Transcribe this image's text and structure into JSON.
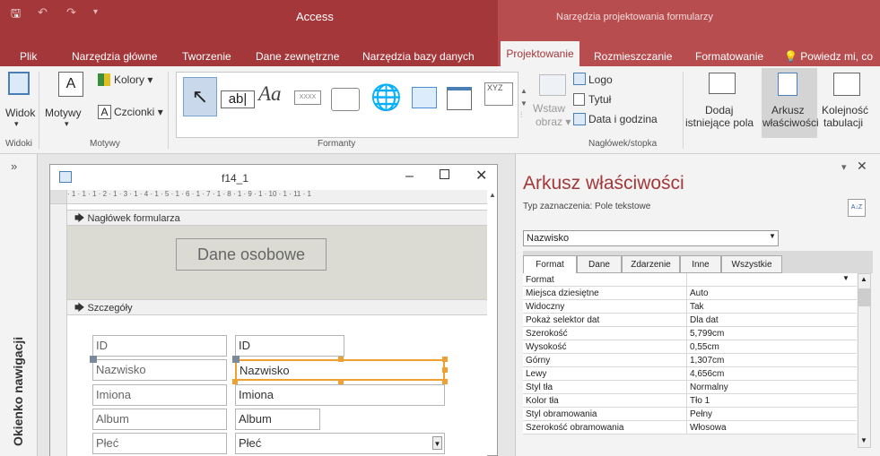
{
  "app": {
    "title": "Access",
    "context_title": "Narzędzia projektowania formularzy"
  },
  "tabs": [
    {
      "label": "Plik"
    },
    {
      "label": "Narzędzia główne"
    },
    {
      "label": "Tworzenie"
    },
    {
      "label": "Dane zewnętrzne"
    },
    {
      "label": "Narzędzia bazy danych"
    },
    {
      "label": "Projektowanie"
    },
    {
      "label": "Rozmieszczanie"
    },
    {
      "label": "Formatowanie"
    },
    {
      "label": "Powiedz mi, co"
    }
  ],
  "ribbon": {
    "widok": "Widok",
    "motywy": "Motywy",
    "kolory": "Kolory",
    "czcionki": "Czcionki",
    "wstaw_obraz_1": "Wstaw",
    "wstaw_obraz_2": "obraz",
    "logo": "Logo",
    "tytul": "Tytuł",
    "data_godzina": "Data i godzina",
    "dodaj_1": "Dodaj",
    "dodaj_2": "istniejące pola",
    "arkusz_1": "Arkusz",
    "arkusz_2": "właściwości",
    "kolejnosc_1": "Kolejność",
    "kolejnosc_2": "tabulacji",
    "gallery": {
      "abl": "ab|",
      "aa": "Aa",
      "xxxx": "XXXX",
      "xyz": "XYZ"
    },
    "groups": {
      "widoki": "Widoki",
      "motywy": "Motywy",
      "formanty": "Formanty",
      "naglowek": "Nagłówek/stopka"
    }
  },
  "nav": {
    "collapse": "»",
    "label": "Okienko nawigacji"
  },
  "form": {
    "title": "f14_1",
    "ruler": "· 1 · 1 · 1 · 2 · 1 · 3 · 1 · 4 · 1 · 5 · 1 · 6 · 1 · 7 · 1 · 8 · 1 · 9 · 1 · 10 · 1 · 11 · 1",
    "header_section": "Nagłówek formularza",
    "header_label": "Dane osobowe",
    "detail_section": "Szczegóły",
    "controls": [
      {
        "label": "ID",
        "field": "ID"
      },
      {
        "label": "Nazwisko",
        "field": "Nazwisko"
      },
      {
        "label": "Imiona",
        "field": "Imiona"
      },
      {
        "label": "Album",
        "field": "Album"
      },
      {
        "label": "Płeć",
        "field": "Płeć"
      }
    ]
  },
  "propsheet": {
    "title": "Arkusz właściwości",
    "selection_type": "Typ zaznaczenia: Pole tekstowe",
    "selected_object": "Nazwisko",
    "sort_icon": "A↓Z",
    "tabs": [
      "Format",
      "Dane",
      "Zdarzenie",
      "Inne",
      "Wszystkie"
    ],
    "rows": [
      {
        "name": "Format",
        "value": ""
      },
      {
        "name": "Miejsca dziesiętne",
        "value": "Auto"
      },
      {
        "name": "Widoczny",
        "value": "Tak"
      },
      {
        "name": "Pokaż selektor dat",
        "value": "Dla dat"
      },
      {
        "name": "Szerokość",
        "value": "5,799cm"
      },
      {
        "name": "Wysokość",
        "value": "0,55cm"
      },
      {
        "name": "Górny",
        "value": "1,307cm"
      },
      {
        "name": "Lewy",
        "value": "4,656cm"
      },
      {
        "name": "Styl tła",
        "value": "Normalny"
      },
      {
        "name": "Kolor tła",
        "value": "Tło 1"
      },
      {
        "name": "Styl obramowania",
        "value": "Pełny"
      },
      {
        "name": "Szerokość obramowania",
        "value": "Włosowa"
      }
    ]
  },
  "colors": {
    "accent": "#a4373a",
    "selection": "#f0a030"
  }
}
